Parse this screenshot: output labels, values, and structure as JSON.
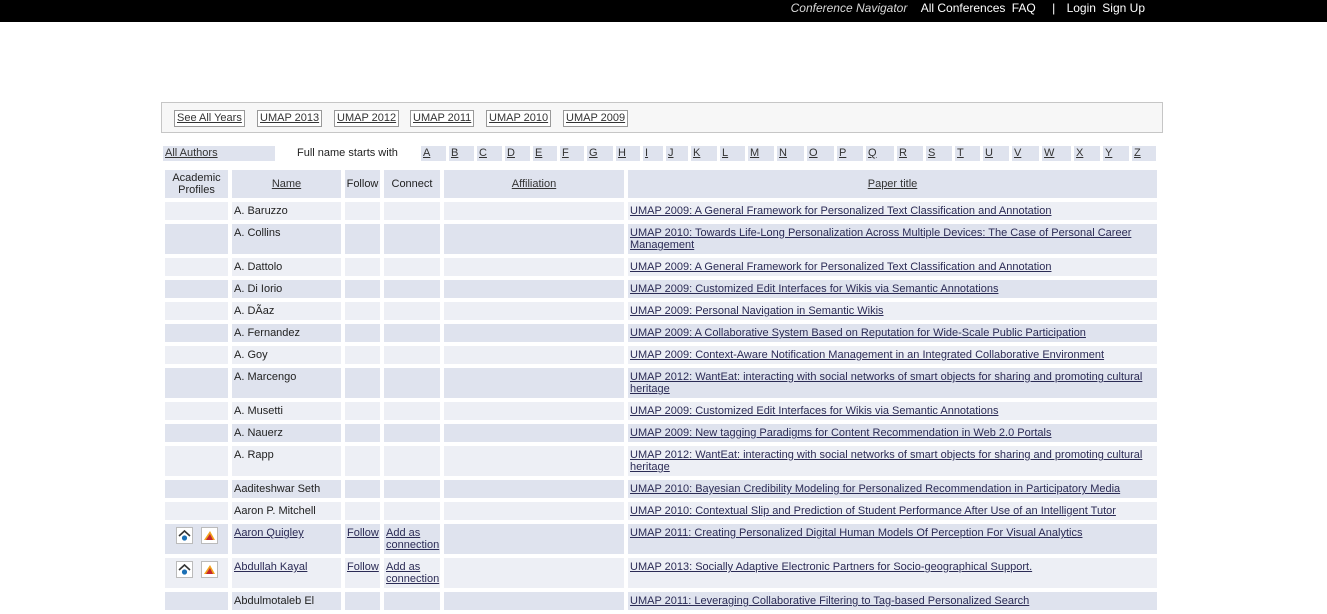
{
  "topbar": {
    "brand": "Conference Navigator",
    "all_conferences": "All Conferences",
    "faq": "FAQ",
    "separator": "|",
    "login": "Login",
    "signup": "Sign Up"
  },
  "years": [
    "See All Years",
    "UMAP 2013",
    "UMAP 2012",
    "UMAP 2011",
    "UMAP 2010",
    "UMAP 2009"
  ],
  "letters_row": {
    "all_authors": "All Authors",
    "full_name_label": "Full name starts with",
    "letters": [
      "A",
      "B",
      "C",
      "D",
      "E",
      "F",
      "G",
      "H",
      "I",
      "J",
      "K",
      "L",
      "M",
      "N",
      "O",
      "P",
      "Q",
      "R",
      "S",
      "T",
      "U",
      "V",
      "W",
      "X",
      "Y",
      "Z"
    ]
  },
  "table": {
    "headers": {
      "profiles_line1": "Academic",
      "profiles_line2": "Profiles",
      "name": "Name",
      "follow": "Follow",
      "connect": "Connect",
      "affiliation": "Affiliation",
      "paper": "Paper title"
    },
    "rows": [
      {
        "name": "A. Baruzzo",
        "paper": "UMAP 2009: A General Framework for Personalized Text Classification and Annotation"
      },
      {
        "name": "A. Collins",
        "paper": "UMAP 2010: Towards Life-Long Personalization Across Multiple Devices: The Case of Personal Career Management"
      },
      {
        "name": "A. Dattolo",
        "paper": "UMAP 2009: A General Framework for Personalized Text Classification and Annotation"
      },
      {
        "name": "A. Di Iorio",
        "paper": "UMAP 2009: Customized Edit Interfaces for Wikis via Semantic Annotations"
      },
      {
        "name": "A. DÃaz",
        "paper": "UMAP 2009: Personal Navigation in Semantic Wikis"
      },
      {
        "name": "A. Fernandez",
        "paper": "UMAP 2009: A Collaborative System Based on Reputation for Wide-Scale Public Participation"
      },
      {
        "name": "A. Goy",
        "paper": "UMAP 2009: Context-Aware Notification Management in an Integrated Collaborative Environment"
      },
      {
        "name": "A. Marcengo",
        "paper": "UMAP 2012: WantEat: interacting with social networks of smart objects for sharing and promoting cultural heritage"
      },
      {
        "name": "A. Musetti",
        "paper": "UMAP 2009: Customized Edit Interfaces for Wikis via Semantic Annotations"
      },
      {
        "name": "A. Nauerz",
        "paper": "UMAP 2009: New tagging Paradigms for Content Recommendation in Web 2.0 Portals"
      },
      {
        "name": "A. Rapp",
        "paper": "UMAP 2012: WantEat: interacting with social networks of smart objects for sharing and promoting cultural heritage"
      },
      {
        "name": "Aaditeshwar Seth",
        "paper": "UMAP 2010: Bayesian Credibility Modeling for Personalized Recommendation in Participatory Media"
      },
      {
        "name": "Aaron P. Mitchell",
        "paper": "UMAP 2010: Contextual Slip and Prediction of Student Performance After Use of an Intelligent Tutor"
      },
      {
        "name": "Aaron Quigley",
        "paper": "UMAP 2011: Creating Personalized Digital Human Models Of Perception For Visual Analytics",
        "follow": "Follow",
        "connect_line1": "Add as",
        "connect_line2": "connection",
        "profiles": true
      },
      {
        "name": "Abdullah Kayal",
        "paper": "UMAP 2013: Socially Adaptive Electronic Partners for Socio-geographical Support.",
        "follow": "Follow",
        "connect_line1": "Add as",
        "connect_line2": "connection",
        "profiles": true
      },
      {
        "name": "Abdulmotaleb El",
        "paper": "UMAP 2011: Leveraging Collaborative Filtering to Tag-based Personalized Search"
      }
    ]
  },
  "colors": {
    "topbar": "#000000",
    "cell": "#dfe3ee",
    "cell_alt": "#edeff5"
  },
  "icons": [
    "google-scholar-icon",
    "mendeley-icon"
  ]
}
